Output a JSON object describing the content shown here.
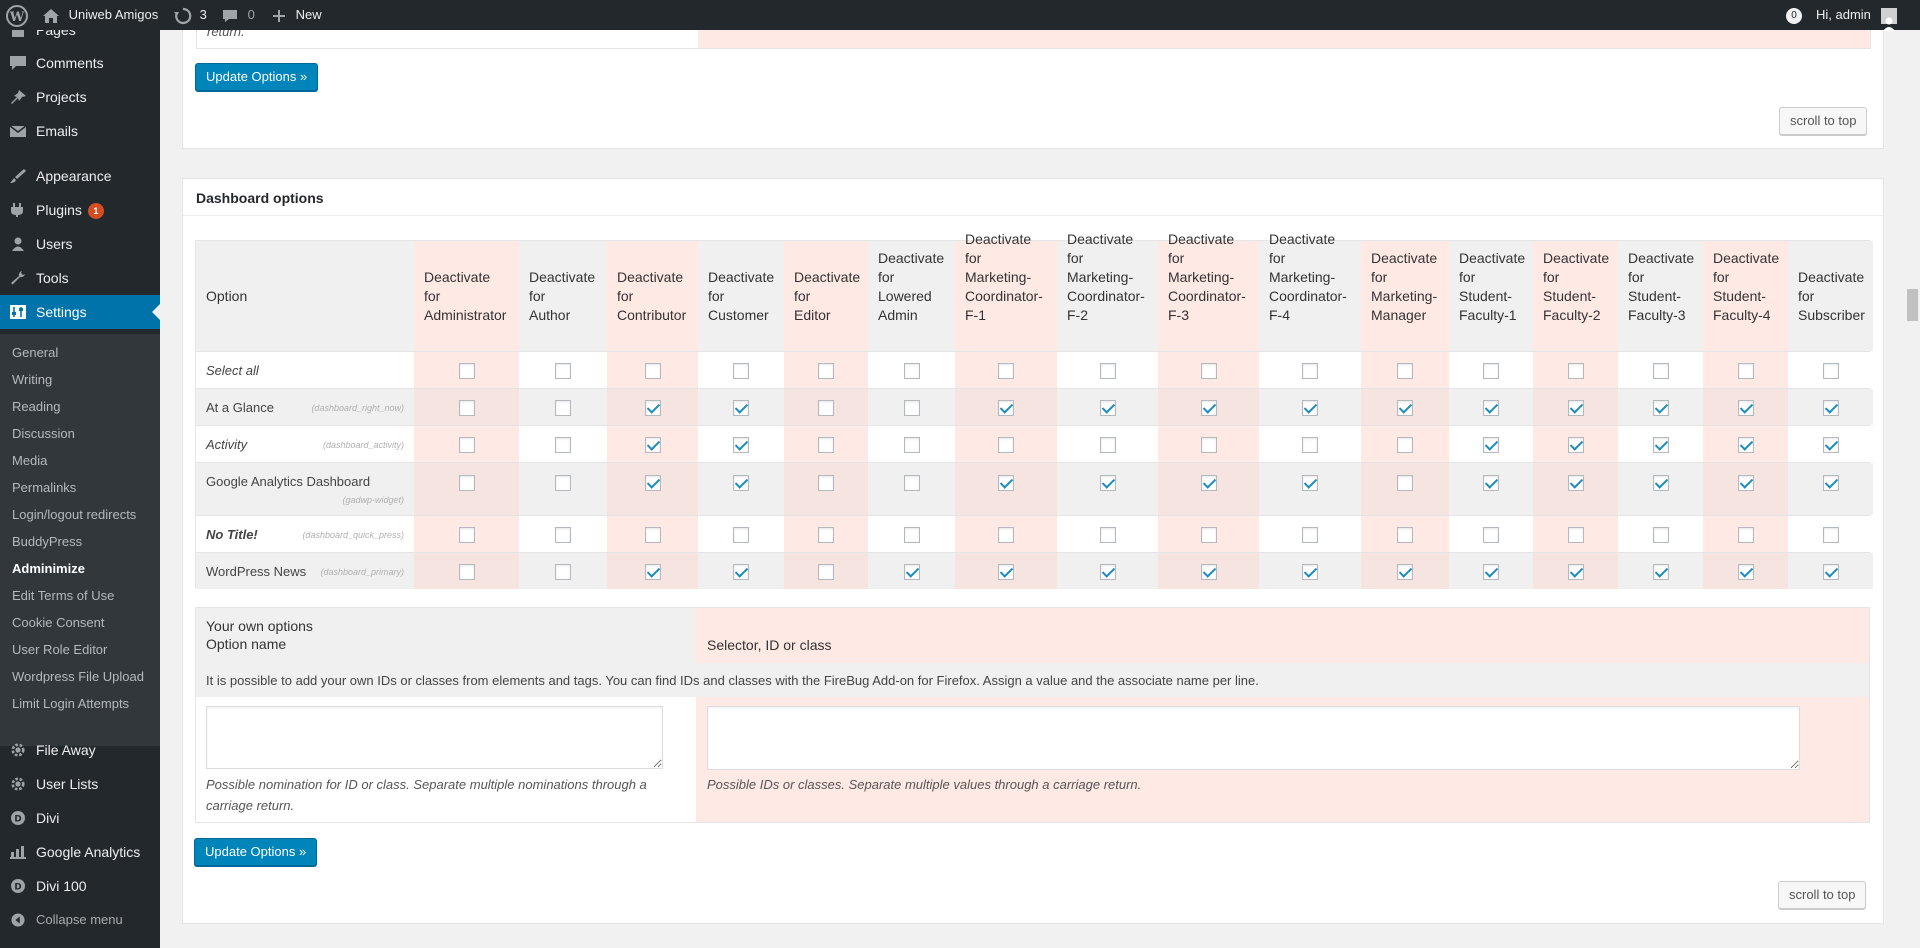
{
  "adminbar": {
    "site_name": "Uniweb Amigos",
    "updates_count": "3",
    "comments_count": "0",
    "new_label": "New",
    "notif_count": "0",
    "greeting": "Hi, admin"
  },
  "menu": {
    "items_top": [
      {
        "label": "Pages",
        "icon": "pages-icon"
      },
      {
        "label": "Comments",
        "icon": "comments-icon"
      },
      {
        "label": "Projects",
        "icon": "pin-icon"
      },
      {
        "label": "Emails",
        "icon": "mail-icon"
      },
      {
        "label": "Appearance",
        "icon": "brush-icon"
      },
      {
        "label": "Plugins",
        "icon": "plugin-icon",
        "badge": "1"
      },
      {
        "label": "Users",
        "icon": "users-icon"
      },
      {
        "label": "Tools",
        "icon": "wrench-icon"
      },
      {
        "label": "Settings",
        "icon": "settings-icon"
      }
    ],
    "submenu": [
      "General",
      "Writing",
      "Reading",
      "Discussion",
      "Media",
      "Permalinks",
      "Login/logout redirects",
      "BuddyPress",
      "Adminimize",
      "Edit Terms of Use",
      "Cookie Consent",
      "User Role Editor",
      "Wordpress File Upload",
      "Limit Login Attempts"
    ],
    "items_bottom": [
      {
        "label": "File Away",
        "icon": "gear-icon"
      },
      {
        "label": "User Lists",
        "icon": "gear-icon"
      },
      {
        "label": "Divi",
        "icon": "divi-icon"
      },
      {
        "label": "Google Analytics",
        "icon": "analytics-icon"
      },
      {
        "label": "Divi 100",
        "icon": "divi-icon"
      },
      {
        "label": "Collapse menu",
        "icon": "collapse-icon"
      }
    ]
  },
  "top_section": {
    "cut_text": "return.",
    "update_button": "Update Options »",
    "scroll_button": "scroll to top"
  },
  "dashboard": {
    "title": "Dashboard options",
    "option_header": "Option",
    "roles": [
      "Deactivate\nfor\nAdministrator",
      "Deactivate\nfor\nAuthor",
      "Deactivate\nfor\nContributor",
      "Deactivate\nfor\nCustomer",
      "Deactivate\nfor\nEditor",
      "Deactivate\nfor\nLowered\nAdmin",
      "Deactivate\nfor\nMarketing-\nCoordinator-\nF-1",
      "Deactivate\nfor\nMarketing-\nCoordinator-\nF-2",
      "Deactivate\nfor\nMarketing-\nCoordinator-\nF-3",
      "Deactivate\nfor\nMarketing-\nCoordinator-\nF-4",
      "Deactivate\nfor\nMarketing-\nManager",
      "Deactivate\nfor\nStudent-\nFaculty-1",
      "Deactivate\nfor\nStudent-\nFaculty-2",
      "Deactivate\nfor\nStudent-\nFaculty-3",
      "Deactivate\nfor\nStudent-\nFaculty-4",
      "Deactivate\nfor\nSubscriber"
    ],
    "rows": [
      {
        "name": "Select all",
        "id": "",
        "italic": true,
        "checked": [
          0,
          0,
          0,
          0,
          0,
          0,
          0,
          0,
          0,
          0,
          0,
          0,
          0,
          0,
          0,
          0
        ]
      },
      {
        "name": "At a Glance",
        "id": "(dashboard_right_now)",
        "italic": false,
        "checked": [
          0,
          0,
          1,
          1,
          0,
          0,
          1,
          1,
          1,
          1,
          1,
          1,
          1,
          1,
          1,
          1
        ]
      },
      {
        "name": "Activity",
        "id": "(dashboard_activity)",
        "italic": true,
        "checked": [
          0,
          0,
          1,
          1,
          0,
          0,
          0,
          0,
          0,
          0,
          0,
          1,
          1,
          1,
          1,
          1
        ]
      },
      {
        "name": "Google Analytics Dashboard",
        "id": "(gadwp-widget)",
        "italic": false,
        "checked": [
          0,
          0,
          1,
          1,
          0,
          0,
          1,
          1,
          1,
          1,
          0,
          1,
          1,
          1,
          1,
          1
        ]
      },
      {
        "name": "No Title!",
        "id": "(dashboard_quick_press)",
        "italic": true,
        "bold": true,
        "checked": [
          0,
          0,
          0,
          0,
          0,
          0,
          0,
          0,
          0,
          0,
          0,
          0,
          0,
          0,
          0,
          0
        ]
      },
      {
        "name": "WordPress News",
        "id": "(dashboard_primary)",
        "italic": false,
        "checked": [
          0,
          0,
          1,
          1,
          0,
          1,
          1,
          1,
          1,
          1,
          1,
          1,
          1,
          1,
          1,
          1
        ]
      }
    ],
    "own": {
      "heading": "Your own options",
      "name_col": "Option name",
      "selector_col": "Selector, ID or class",
      "hint": "It is possible to add your own IDs or classes from elements and tags. You can find IDs and classes with the FireBug Add-on for Firefox. Assign a value and the associate name per line.",
      "name_desc": "Possible nomination for ID or class. Separate multiple nominations through a carriage return.",
      "selector_desc": "Possible IDs or classes. Separate multiple values through a carriage return."
    },
    "update_button": "Update Options »",
    "scroll_button": "scroll to top"
  }
}
